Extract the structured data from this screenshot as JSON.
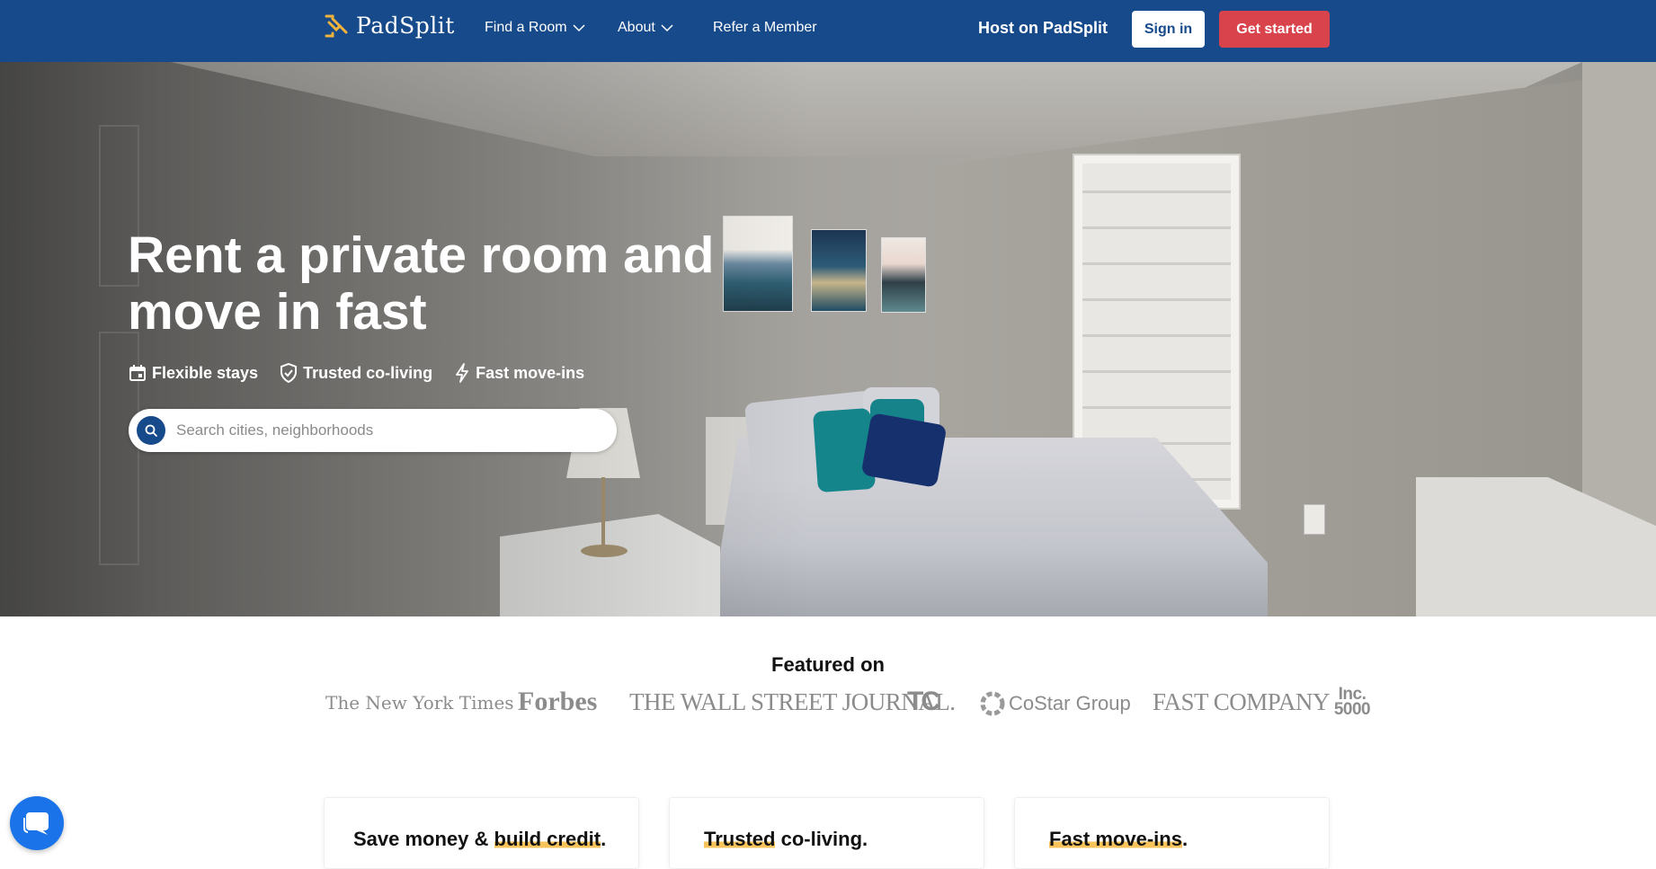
{
  "nav": {
    "brand": "PadSplit",
    "links": [
      {
        "label": "Find a Room",
        "has_dropdown": true
      },
      {
        "label": "About",
        "has_dropdown": true
      },
      {
        "label": "Refer a Member",
        "has_dropdown": false
      }
    ],
    "host_label": "Host on PadSplit",
    "signin_label": "Sign in",
    "get_started_label": "Get started"
  },
  "hero": {
    "title_line1": "Rent a private room and",
    "title_line2": "move in fast",
    "features": [
      {
        "icon": "calendar-icon",
        "label": "Flexible stays"
      },
      {
        "icon": "shield-check-icon",
        "label": "Trusted co-living"
      },
      {
        "icon": "lightning-icon",
        "label": "Fast move-ins"
      }
    ],
    "search_placeholder": "Search cities, neighborhoods",
    "carousel_dots": 5,
    "active_dot": 5
  },
  "featured": {
    "title": "Featured on",
    "outlets": [
      "The New York Times",
      "Forbes",
      "THE WALL STREET JOURNAL.",
      "TC",
      "CoStar Group",
      "FAST COMPANY",
      "Inc. 5000"
    ]
  },
  "cards": [
    {
      "prefix": "Save money & ",
      "highlight": "build credit",
      "suffix": "."
    },
    {
      "prefix": "",
      "highlight": "Trusted",
      "suffix": " co-living."
    },
    {
      "prefix": "",
      "highlight": "Fast move-ins",
      "suffix": "."
    }
  ],
  "colors": {
    "nav_bg": "#174a8b",
    "accent_red": "#d9434b",
    "highlight_yellow": "#f7c35a",
    "chat_blue": "#1a73e8"
  }
}
